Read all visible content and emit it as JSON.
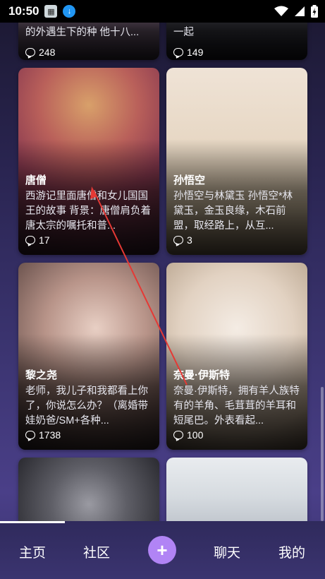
{
  "status_bar": {
    "time": "10:50"
  },
  "cards": {
    "c0": {
      "desc": "的外遇生下的种 他十八...",
      "count": "248"
    },
    "c1": {
      "desc": "一起",
      "count": "149"
    },
    "c2": {
      "name": "唐僧",
      "desc": "西游记里面唐僧和女儿国国王的故事 背景：唐僧肩负着唐太宗的嘱托和普...",
      "count": "17"
    },
    "c3": {
      "name": "孙悟空",
      "desc": "孙悟空与林黛玉 孙悟空*林黛玉，金玉良缘，木石前盟，取经路上，从互...",
      "count": "3"
    },
    "c4": {
      "name": "黎之尧",
      "desc": "老师，我儿子和我都看上你了，你说怎么办？（离婚带娃奶爸/SM+各种...",
      "count": "1738"
    },
    "c5": {
      "name": "奈曼·伊斯特",
      "desc": "奈曼·伊斯特，拥有羊人族特有的羊角、毛茸茸的羊耳和短尾巴。外表看起...",
      "count": "100"
    }
  },
  "nav": {
    "home": "主页",
    "community": "社区",
    "plus": "+",
    "chat": "聊天",
    "mine": "我的"
  },
  "icons": {
    "comment": "comment-bubble-icon",
    "wifi": "wifi-icon",
    "signal": "signal-icon",
    "battery": "battery-charging-icon"
  }
}
